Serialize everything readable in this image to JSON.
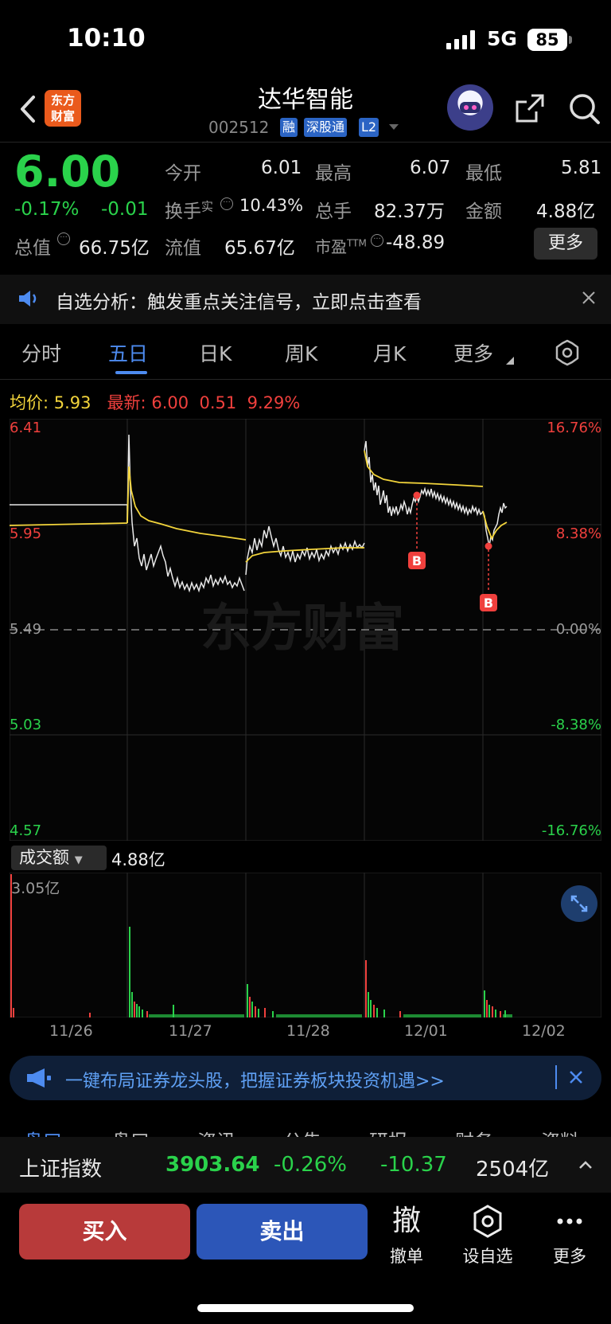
{
  "status_bar": {
    "time": "10:10",
    "network": "5G",
    "battery": "85"
  },
  "header": {
    "brand_logo": "东方\n财富",
    "title": "达华智能",
    "code": "002512",
    "tags": [
      "融",
      "深股通",
      "L2"
    ]
  },
  "quote": {
    "price": "6.00",
    "change_pct": "-0.17%",
    "change_abs": "-0.01",
    "open_label": "今开",
    "open": "6.01",
    "high_label": "最高",
    "high": "6.07",
    "low_label": "最低",
    "low": "5.81",
    "turnover_label": "换手",
    "turnover_sup": "实",
    "turnover": "10.43%",
    "volume_label": "总手",
    "volume": "82.37万",
    "amount_label": "金额",
    "amount": "4.88亿",
    "mktcap_label": "总值",
    "mktcap": "66.75亿",
    "float_label": "流值",
    "float": "65.67亿",
    "pe_label": "市盈",
    "pe_sup": "TTM",
    "pe": "-48.89",
    "more": "更多"
  },
  "notice": {
    "text": "自选分析：触发重点关注信号，立即点击查看"
  },
  "tabs": [
    "分时",
    "五日",
    "日K",
    "周K",
    "月K",
    "更多"
  ],
  "chart_info": {
    "avg_label": "均价:",
    "avg": "5.93",
    "latest_label": "最新:",
    "latest": "6.00",
    "latest_chg": "0.51",
    "latest_pct": "9.29%"
  },
  "chart_data": {
    "type": "line",
    "x": [
      "11/26",
      "11/27",
      "11/28",
      "12/01",
      "12/02"
    ],
    "y_ticks_left": [
      "6.41",
      "5.95",
      "5.49",
      "5.03",
      "4.57"
    ],
    "y_ticks_right": [
      "16.76%",
      "8.38%",
      "0.00%",
      "-8.38%",
      "-16.76%"
    ],
    "ylim": [
      4.57,
      6.41
    ],
    "series": [],
    "markers": [
      "B",
      "B"
    ],
    "volume": {
      "selector": "成交额",
      "total": "4.88亿",
      "max_label": "3.05亿"
    }
  },
  "promo": {
    "text": "一键布局证券龙头股，把握证券板块投资机遇>>"
  },
  "sub_tabs": [
    "盘口",
    "盘口",
    "资讯",
    "公告",
    "研报",
    "财务",
    "资料"
  ],
  "index_bar": {
    "name": "上证指数",
    "value": "3903.64",
    "pct": "-0.26%",
    "chg": "-10.37",
    "amount": "2504亿"
  },
  "actions": {
    "buy": "买入",
    "sell": "卖出",
    "cancel_glyph": "撤",
    "cancel": "撤单",
    "watch": "设自选",
    "more": "更多"
  },
  "watermark": "东方财富"
}
